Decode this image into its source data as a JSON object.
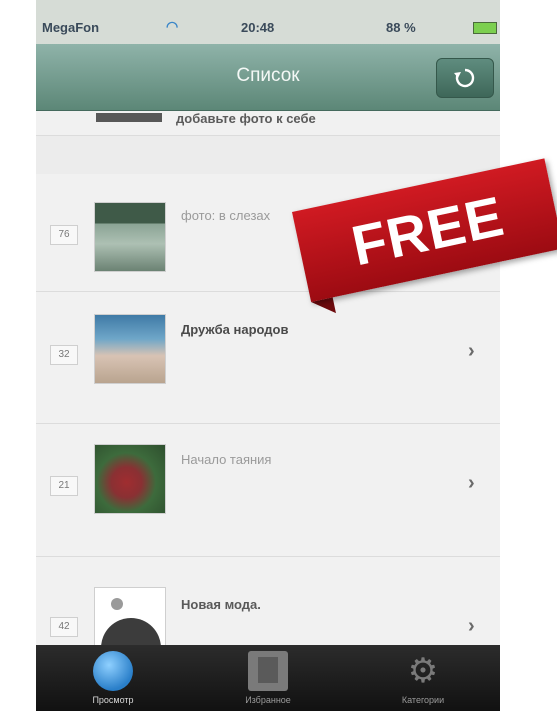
{
  "status_bar": {
    "carrier": "MegaFon",
    "time": "20:48",
    "battery": "88 %"
  },
  "nav_bar": {
    "title": "Список"
  },
  "list": {
    "partial_row_label": "добавьте фото к себе",
    "rows": [
      {
        "number": "76",
        "title": "фото: в слезах",
        "chevron": false
      },
      {
        "number": "32",
        "title": "Дружба народов",
        "chevron": true
      },
      {
        "number": "21",
        "title": "Начало таяния",
        "chevron": true
      },
      {
        "number": "42",
        "title": "Новая мода.",
        "chevron": true
      }
    ]
  },
  "banner": {
    "text": "FREE",
    "color": "#c8141c"
  },
  "tab_bar": {
    "tabs": [
      {
        "label": "Просмотр"
      },
      {
        "label": "Избранное"
      },
      {
        "label": "Категории"
      }
    ]
  },
  "colors": {
    "nav_bar": "#6e9688",
    "tab_bar": "#1c1c1c",
    "list_background": "#f1f1f1"
  }
}
